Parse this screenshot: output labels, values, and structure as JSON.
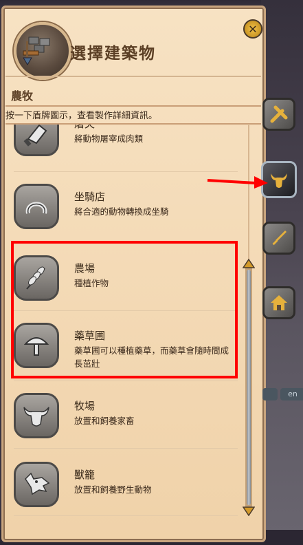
{
  "header": {
    "title": "選擇建築物",
    "close_icon": "close-x-icon"
  },
  "section": {
    "title": "農牧",
    "instruction": "按一下盾牌圖示，查看製作詳細資訊。"
  },
  "items": [
    {
      "name": "屠夫",
      "desc": "將動物屠宰成肉類",
      "icon": "cleaver-icon"
    },
    {
      "name": "坐騎店",
      "desc": "將合適的動物轉換成坐騎",
      "icon": "horseshoe-icon"
    },
    {
      "name": "農場",
      "desc": "種植作物",
      "icon": "wheat-icon"
    },
    {
      "name": "藥草圃",
      "desc": "藥草圃可以種植藥草，而藥草會隨時間成長茁壯",
      "icon": "mushroom-icon"
    },
    {
      "name": "牧場",
      "desc": "放置和飼養家畜",
      "icon": "bull-icon"
    },
    {
      "name": "獸籠",
      "desc": "放置和飼養野生動物",
      "icon": "wolf-icon"
    }
  ],
  "side_tabs": [
    {
      "name": "crafting-tools-tab",
      "icon": "hammer-wrench-icon"
    },
    {
      "name": "farming-tab",
      "icon": "ox-icon",
      "active": true
    },
    {
      "name": "weapons-tab",
      "icon": "sword-icon"
    },
    {
      "name": "housing-tab",
      "icon": "house-icon"
    }
  ],
  "language": "en",
  "colors": {
    "panel": "#f3d8b3",
    "text": "#3a2a1a",
    "annotation": "#ff0000"
  }
}
